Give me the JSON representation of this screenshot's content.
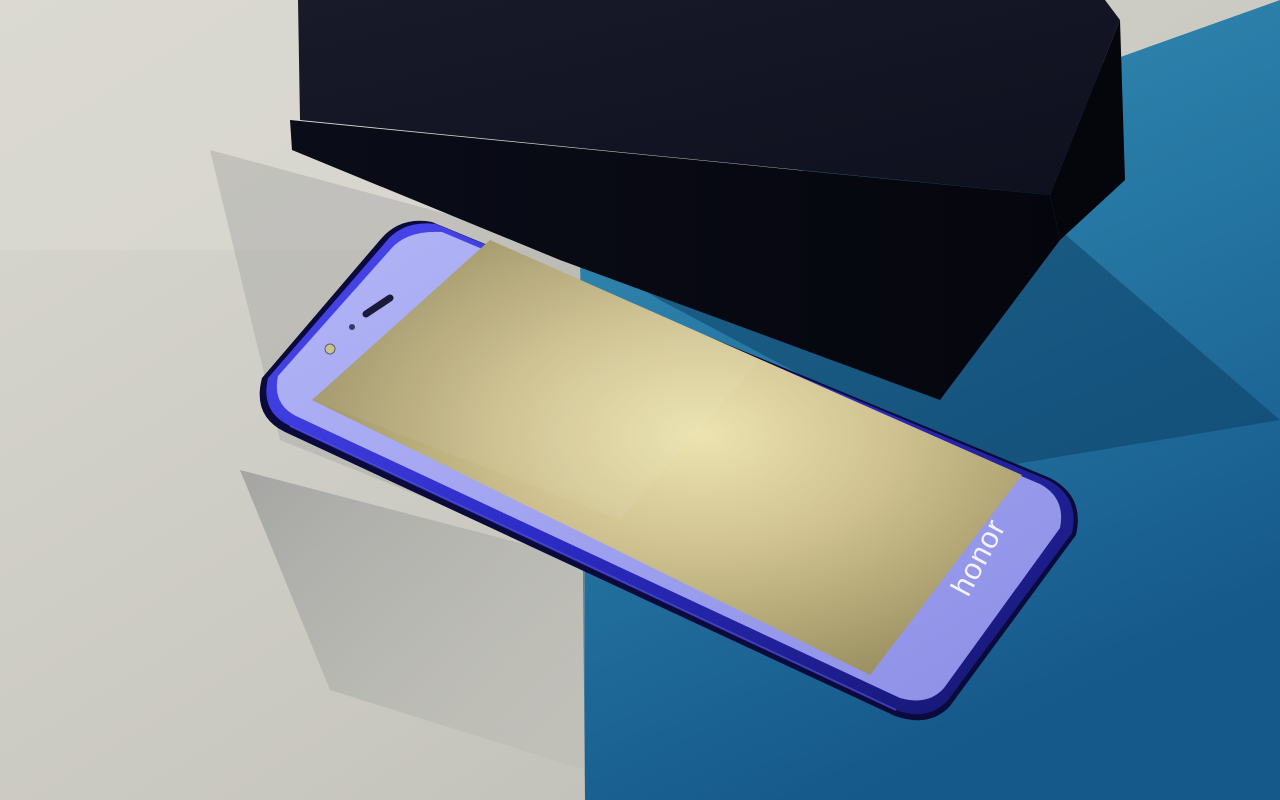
{
  "scene": {
    "description_label": "Product photo",
    "colors": {
      "surface_left": "#d2d1c9",
      "surface_left_shadow": "#a9aaa8",
      "surface_right": "#2a7fa8",
      "surface_right_dark": "#0f4f7e",
      "box_top": "#111426",
      "box_side": "#070914",
      "phone_frame": "#3a38d6",
      "phone_frame_dark": "#0b0d3a",
      "phone_glass": "#9ea0ee",
      "screen_top": "#b8a774",
      "screen_center": "#e2d8a3",
      "screen_bottom": "#8c8458",
      "brand_text": "#f4f4ff"
    }
  },
  "phone": {
    "brand": "honor",
    "icons": {
      "earpiece": "speaker-grille-icon",
      "front_camera": "front-camera-icon",
      "sensor": "proximity-sensor-icon"
    }
  }
}
